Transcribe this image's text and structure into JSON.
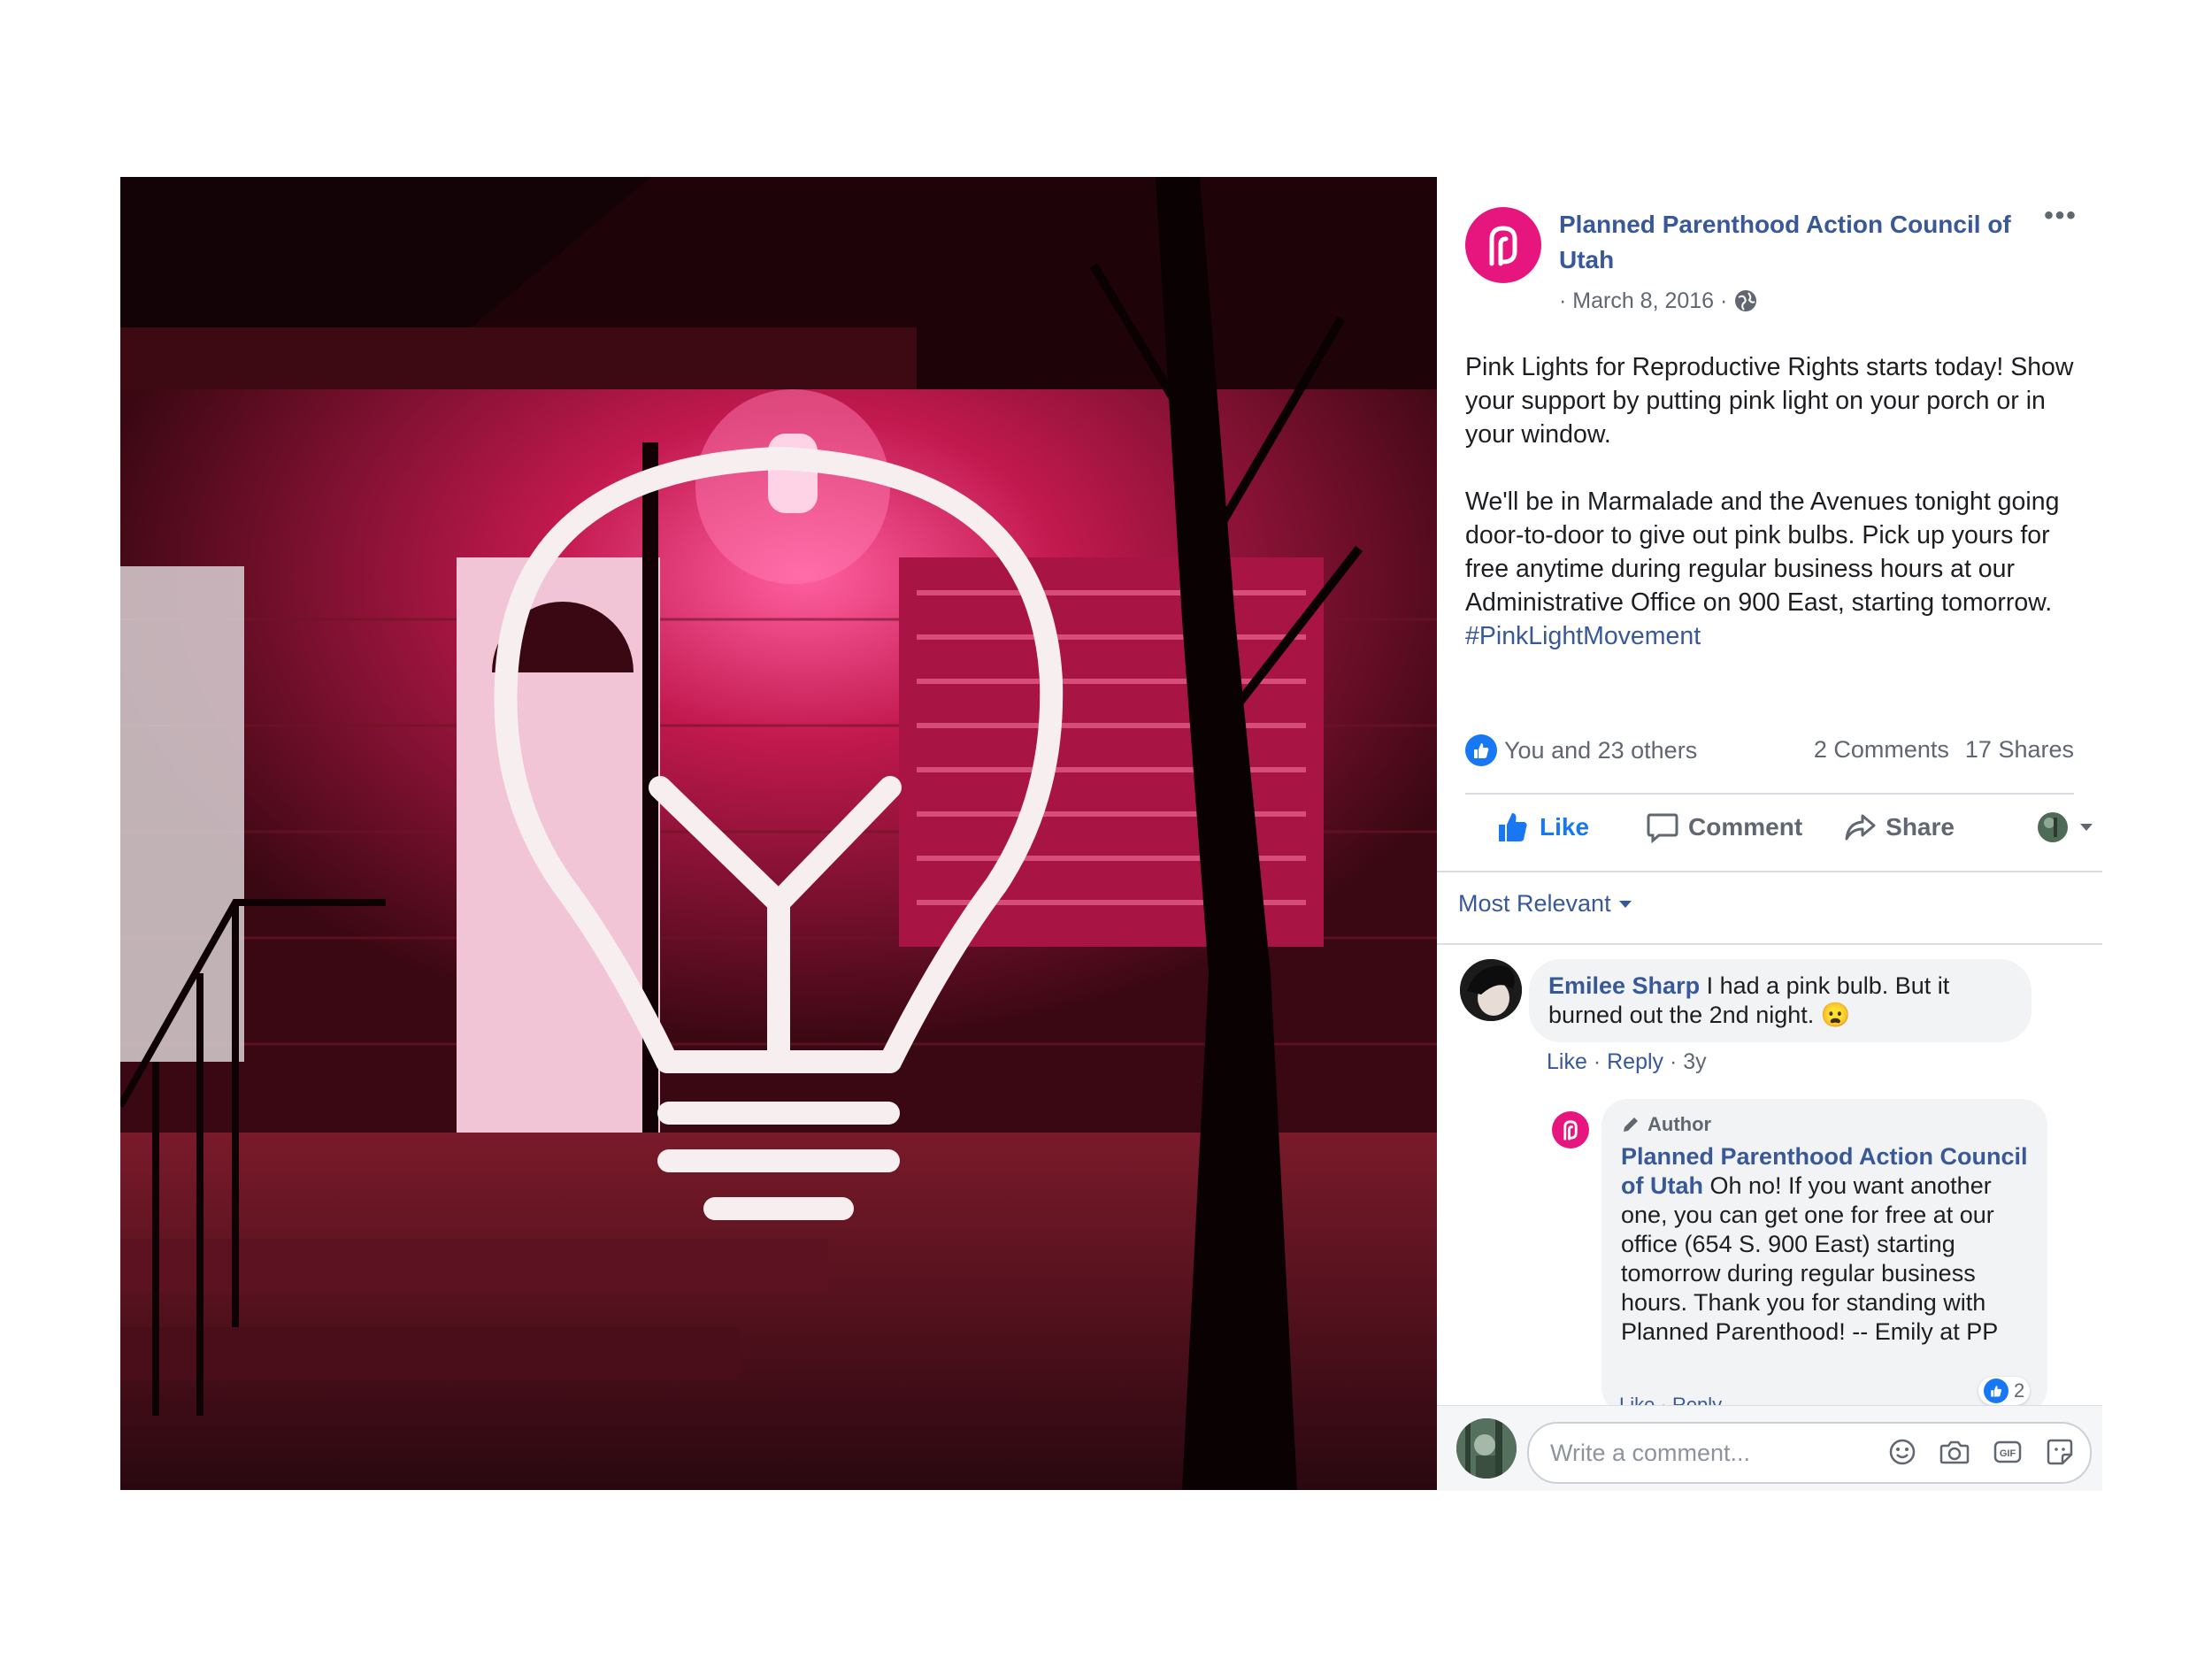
{
  "post": {
    "page_name": "Planned Parenthood Action Council of Utah",
    "date": "· March 8, 2016 ·",
    "paragraph1": "Pink Lights for Reproductive Rights starts today! Show your support by putting pink light on your porch or in your window.",
    "paragraph2": "We'll be in Marmalade and the Avenues tonight going door-to-door to give out pink bulbs. Pick up yours for free anytime during regular business hours at our Administrative Office on 900 East, starting tomorrow.",
    "hashtag": "#PinkLightMovement"
  },
  "stats": {
    "reactions_label": "You and 23 others",
    "comments_label": "2 Comments",
    "shares_label": "17 Shares"
  },
  "actions": {
    "like": "Like",
    "comment": "Comment",
    "share": "Share"
  },
  "comments": {
    "sort_label": "Most Relevant",
    "items": [
      {
        "author": "Emilee Sharp",
        "text": "I had a pink bulb. But it burned out the 2nd night.",
        "emoji": "😦",
        "like": "Like",
        "reply": "Reply",
        "time": "3y"
      }
    ],
    "reply": {
      "badge": "Author",
      "author": "Planned Parenthood Action Council of Utah",
      "text": "Oh no! If you want another one, you can get one for free at our office (654 S. 900 East) starting tomorrow during regular business hours. Thank you for standing with Planned Parenthood! -- Emily at PP",
      "like_count": "2",
      "like": "Like",
      "reply_label": "Reply"
    }
  },
  "composer": {
    "placeholder": "Write a comment..."
  },
  "colors": {
    "brand_pink": "#e6167e",
    "link_blue": "#385898",
    "fb_blue": "#1877f2"
  }
}
